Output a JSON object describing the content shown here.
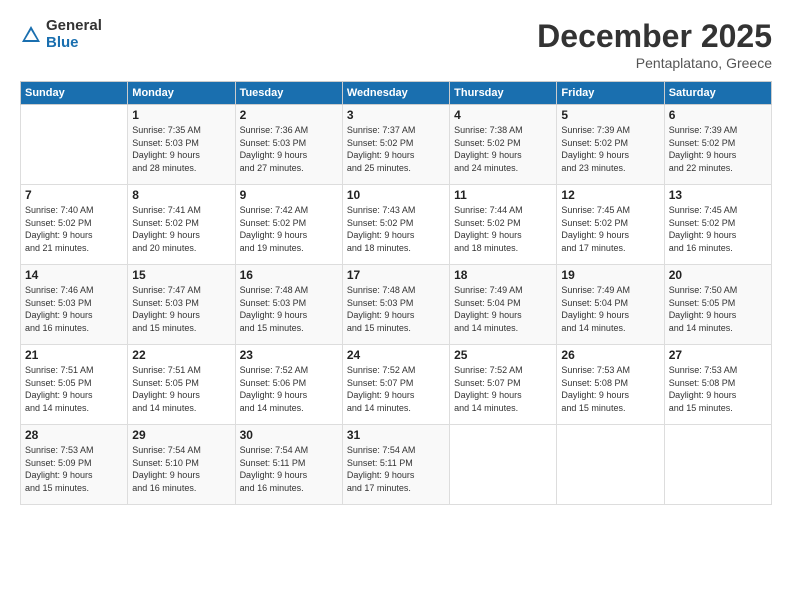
{
  "logo": {
    "general": "General",
    "blue": "Blue"
  },
  "title": "December 2025",
  "location": "Pentaplatano, Greece",
  "headers": [
    "Sunday",
    "Monday",
    "Tuesday",
    "Wednesday",
    "Thursday",
    "Friday",
    "Saturday"
  ],
  "weeks": [
    [
      {
        "day": "",
        "info": ""
      },
      {
        "day": "1",
        "info": "Sunrise: 7:35 AM\nSunset: 5:03 PM\nDaylight: 9 hours\nand 28 minutes."
      },
      {
        "day": "2",
        "info": "Sunrise: 7:36 AM\nSunset: 5:03 PM\nDaylight: 9 hours\nand 27 minutes."
      },
      {
        "day": "3",
        "info": "Sunrise: 7:37 AM\nSunset: 5:02 PM\nDaylight: 9 hours\nand 25 minutes."
      },
      {
        "day": "4",
        "info": "Sunrise: 7:38 AM\nSunset: 5:02 PM\nDaylight: 9 hours\nand 24 minutes."
      },
      {
        "day": "5",
        "info": "Sunrise: 7:39 AM\nSunset: 5:02 PM\nDaylight: 9 hours\nand 23 minutes."
      },
      {
        "day": "6",
        "info": "Sunrise: 7:39 AM\nSunset: 5:02 PM\nDaylight: 9 hours\nand 22 minutes."
      }
    ],
    [
      {
        "day": "7",
        "info": "Sunrise: 7:40 AM\nSunset: 5:02 PM\nDaylight: 9 hours\nand 21 minutes."
      },
      {
        "day": "8",
        "info": "Sunrise: 7:41 AM\nSunset: 5:02 PM\nDaylight: 9 hours\nand 20 minutes."
      },
      {
        "day": "9",
        "info": "Sunrise: 7:42 AM\nSunset: 5:02 PM\nDaylight: 9 hours\nand 19 minutes."
      },
      {
        "day": "10",
        "info": "Sunrise: 7:43 AM\nSunset: 5:02 PM\nDaylight: 9 hours\nand 18 minutes."
      },
      {
        "day": "11",
        "info": "Sunrise: 7:44 AM\nSunset: 5:02 PM\nDaylight: 9 hours\nand 18 minutes."
      },
      {
        "day": "12",
        "info": "Sunrise: 7:45 AM\nSunset: 5:02 PM\nDaylight: 9 hours\nand 17 minutes."
      },
      {
        "day": "13",
        "info": "Sunrise: 7:45 AM\nSunset: 5:02 PM\nDaylight: 9 hours\nand 16 minutes."
      }
    ],
    [
      {
        "day": "14",
        "info": "Sunrise: 7:46 AM\nSunset: 5:03 PM\nDaylight: 9 hours\nand 16 minutes."
      },
      {
        "day": "15",
        "info": "Sunrise: 7:47 AM\nSunset: 5:03 PM\nDaylight: 9 hours\nand 15 minutes."
      },
      {
        "day": "16",
        "info": "Sunrise: 7:48 AM\nSunset: 5:03 PM\nDaylight: 9 hours\nand 15 minutes."
      },
      {
        "day": "17",
        "info": "Sunrise: 7:48 AM\nSunset: 5:03 PM\nDaylight: 9 hours\nand 15 minutes."
      },
      {
        "day": "18",
        "info": "Sunrise: 7:49 AM\nSunset: 5:04 PM\nDaylight: 9 hours\nand 14 minutes."
      },
      {
        "day": "19",
        "info": "Sunrise: 7:49 AM\nSunset: 5:04 PM\nDaylight: 9 hours\nand 14 minutes."
      },
      {
        "day": "20",
        "info": "Sunrise: 7:50 AM\nSunset: 5:05 PM\nDaylight: 9 hours\nand 14 minutes."
      }
    ],
    [
      {
        "day": "21",
        "info": "Sunrise: 7:51 AM\nSunset: 5:05 PM\nDaylight: 9 hours\nand 14 minutes."
      },
      {
        "day": "22",
        "info": "Sunrise: 7:51 AM\nSunset: 5:05 PM\nDaylight: 9 hours\nand 14 minutes."
      },
      {
        "day": "23",
        "info": "Sunrise: 7:52 AM\nSunset: 5:06 PM\nDaylight: 9 hours\nand 14 minutes."
      },
      {
        "day": "24",
        "info": "Sunrise: 7:52 AM\nSunset: 5:07 PM\nDaylight: 9 hours\nand 14 minutes."
      },
      {
        "day": "25",
        "info": "Sunrise: 7:52 AM\nSunset: 5:07 PM\nDaylight: 9 hours\nand 14 minutes."
      },
      {
        "day": "26",
        "info": "Sunrise: 7:53 AM\nSunset: 5:08 PM\nDaylight: 9 hours\nand 15 minutes."
      },
      {
        "day": "27",
        "info": "Sunrise: 7:53 AM\nSunset: 5:08 PM\nDaylight: 9 hours\nand 15 minutes."
      }
    ],
    [
      {
        "day": "28",
        "info": "Sunrise: 7:53 AM\nSunset: 5:09 PM\nDaylight: 9 hours\nand 15 minutes."
      },
      {
        "day": "29",
        "info": "Sunrise: 7:54 AM\nSunset: 5:10 PM\nDaylight: 9 hours\nand 16 minutes."
      },
      {
        "day": "30",
        "info": "Sunrise: 7:54 AM\nSunset: 5:11 PM\nDaylight: 9 hours\nand 16 minutes."
      },
      {
        "day": "31",
        "info": "Sunrise: 7:54 AM\nSunset: 5:11 PM\nDaylight: 9 hours\nand 17 minutes."
      },
      {
        "day": "",
        "info": ""
      },
      {
        "day": "",
        "info": ""
      },
      {
        "day": "",
        "info": ""
      }
    ]
  ]
}
